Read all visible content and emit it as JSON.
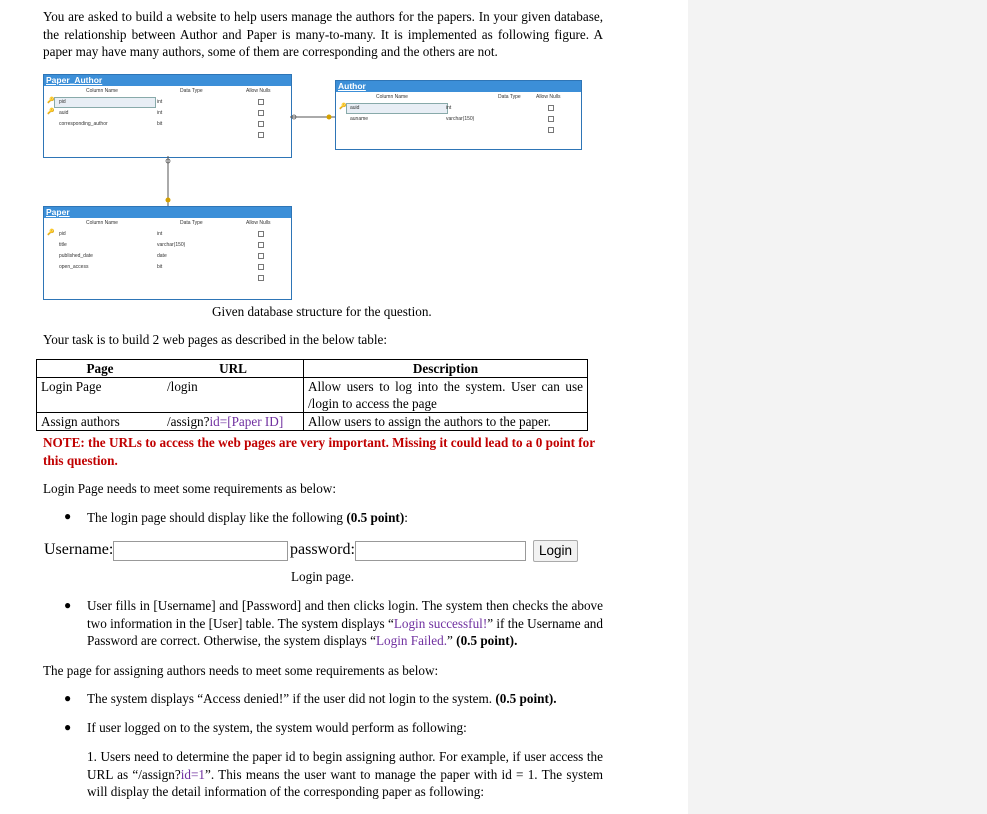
{
  "intro": "You are asked to build a website to help users manage the authors for the papers. In your given database, the relationship between Author and Paper is many-to-many. It is implemented as following figure. A paper may have many authors, some of them are corresponding and the others are not.",
  "diagram": {
    "paper_author": {
      "title": "Paper_Author",
      "headers": [
        "Column Name",
        "Data Type",
        "Allow Nulls"
      ],
      "rows": [
        {
          "name": "pid",
          "type": "int"
        },
        {
          "name": "auid",
          "type": "int"
        },
        {
          "name": "corresponding_author",
          "type": "bit"
        }
      ]
    },
    "author": {
      "title": "Author",
      "headers": [
        "Column Name",
        "Data Type",
        "Allow Nulls"
      ],
      "rows": [
        {
          "name": "auid",
          "type": "int"
        },
        {
          "name": "auname",
          "type": "varchar(150)"
        }
      ]
    },
    "paper": {
      "title": "Paper",
      "headers": [
        "Column Name",
        "Data Type",
        "Allow Nulls"
      ],
      "rows": [
        {
          "name": "pid",
          "type": "int"
        },
        {
          "name": "title",
          "type": "varchar(150)"
        },
        {
          "name": "published_date",
          "type": "date"
        },
        {
          "name": "open_access",
          "type": "bit"
        }
      ]
    },
    "caption": "Given database structure for the question."
  },
  "task_intro": "Your task is to build 2 web pages as described in the below table:",
  "pages_table": {
    "headers": [
      "Page",
      "URL",
      "Description"
    ],
    "rows": [
      {
        "page": "Login Page",
        "url": "/login",
        "url_extra": "",
        "url_end": "",
        "desc": "Allow users to log into the system. User can use /login to access the page"
      },
      {
        "page": "Assign authors",
        "url": "/assign?",
        "url_extra": "id=[Paper ID]",
        "url_end": "",
        "desc": "Allow users to assign the authors to the paper."
      }
    ]
  },
  "note": "NOTE: the URLs to access the web pages are very important. Missing it could lead to a 0 point for this question.",
  "login_req_intro": "Login Page needs to meet some requirements as below:",
  "bullet1": {
    "text": "The login page should display like the following ",
    "points": "(0.5 point)",
    "end": ":"
  },
  "login_form": {
    "username_label": "Username:",
    "password_label": "password:",
    "button": "Login",
    "caption": "Login page."
  },
  "bullet2": {
    "p1": "User fills in [Username] and [Password] and then clicks login. The system then checks the above two information in the [User] table. The system displays “",
    "success": "Login successful!",
    "p2": "” if the Username and Password are correct. Otherwise, the system displays “",
    "failed": "Login Failed.",
    "p3": "” ",
    "points": "(0.5 point)",
    "end": "."
  },
  "assign_req_intro": "The page for assigning authors needs to meet some requirements as below:",
  "bullet3": {
    "text": "The system displays “Access denied!” if the user did not login to the system. ",
    "points": "(0.5 point)."
  },
  "bullet4": {
    "text": "If user logged on to the system, the system would perform as following:"
  },
  "step1": {
    "p1": "1. Users need to determine the paper id to begin assigning author. For example, if user access the URL as “/assign?",
    "id": "id=1",
    "p2": "”. This means the user want to manage the paper with id = 1. The system will display the detail information of the corresponding paper as following:"
  },
  "colors": {
    "accent": "#3c8fd8",
    "note": "#c00000",
    "highlight": "#7030a0",
    "panel": "#f3f3f3"
  },
  "icons": [
    "key-icon",
    "checkbox-icon",
    "bullet-icon"
  ]
}
